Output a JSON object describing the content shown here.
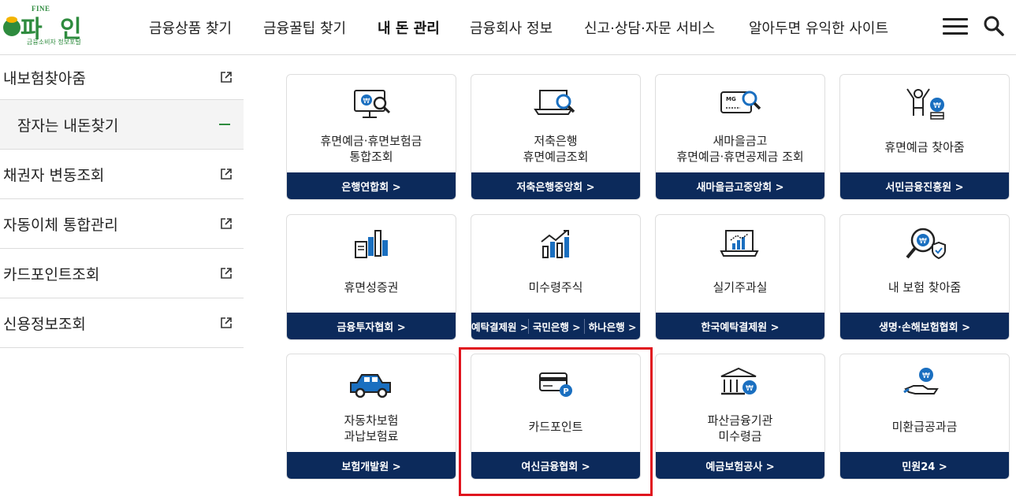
{
  "logo": {
    "fine": "FINE",
    "name": "파 인",
    "sub": "금융소비자 정보포털"
  },
  "nav": [
    {
      "label": "금융상품 찾기",
      "active": false
    },
    {
      "label": "금융꿀팁 찾기",
      "active": false
    },
    {
      "label": "내 돈 관리",
      "active": true
    },
    {
      "label": "금융회사 정보",
      "active": false
    },
    {
      "label": "신고·상담·자문 서비스",
      "active": false
    },
    {
      "label": "알아두면 유익한 사이트",
      "active": false
    }
  ],
  "sidebar": [
    {
      "label": "내보험찾아줌",
      "icon": "external-link-icon"
    },
    {
      "label": "잠자는 내돈찾기",
      "icon": "minus-icon",
      "selected": true
    },
    {
      "label": "채권자 변동조회",
      "icon": "external-link-icon"
    },
    {
      "label": "자동이체 통합관리",
      "icon": "external-link-icon"
    },
    {
      "label": "카드포인트조회",
      "icon": "external-link-icon"
    },
    {
      "label": "신용정보조회",
      "icon": "external-link-icon"
    }
  ],
  "cards": [
    {
      "title": [
        "휴면예금·휴면보험금",
        "통합조회"
      ],
      "links": [
        "은행연합회 >"
      ],
      "icon": "monitor-search-icon"
    },
    {
      "title": [
        "저축은행",
        "휴면예금조회"
      ],
      "links": [
        "저축은행중앙회 >"
      ],
      "icon": "laptop-search-icon"
    },
    {
      "title": [
        "새마을금고",
        "휴면예금·휴면공제금 조회"
      ],
      "links": [
        "새마을금고중앙회 >"
      ],
      "icon": "card-search-icon",
      "card_text": "MG"
    },
    {
      "title": [
        "휴면예금 찾아줌"
      ],
      "links": [
        "서민금융진흥원 >"
      ],
      "icon": "person-coin-icon"
    },
    {
      "title": [
        "휴면성증권"
      ],
      "links": [
        "금융투자협회 >"
      ],
      "icon": "document-chart-icon"
    },
    {
      "title": [
        "미수령주식"
      ],
      "links": [
        "예탁결제원 >",
        "국민은행 >",
        "하나은행 >"
      ],
      "icon": "rising-chart-icon"
    },
    {
      "title": [
        "실기주과실"
      ],
      "links": [
        "한국예탁결제원 >"
      ],
      "icon": "laptop-chart-icon"
    },
    {
      "title": [
        "내 보험 찾아줌"
      ],
      "links": [
        "생명·손해보험협회 >"
      ],
      "icon": "magnifier-shield-icon"
    },
    {
      "title": [
        "자동차보험",
        "과납보험료"
      ],
      "links": [
        "보험개발원 >"
      ],
      "icon": "car-icon"
    },
    {
      "title": [
        "카드포인트"
      ],
      "links": [
        "여신금융협회 >"
      ],
      "icon": "credit-card-point-icon",
      "badge": "P"
    },
    {
      "title": [
        "파산금융기관",
        "미수령금"
      ],
      "links": [
        "예금보험공사 >"
      ],
      "icon": "bank-coin-icon"
    },
    {
      "title": [
        "미환급공과금"
      ],
      "links": [
        "민원24 >"
      ],
      "icon": "hand-coin-icon"
    }
  ],
  "colors": {
    "brand_green": "#2e8b3e",
    "navy": "#0c2a5b",
    "icon_blue": "#1a6fc0",
    "highlight_red": "#e0141e"
  }
}
